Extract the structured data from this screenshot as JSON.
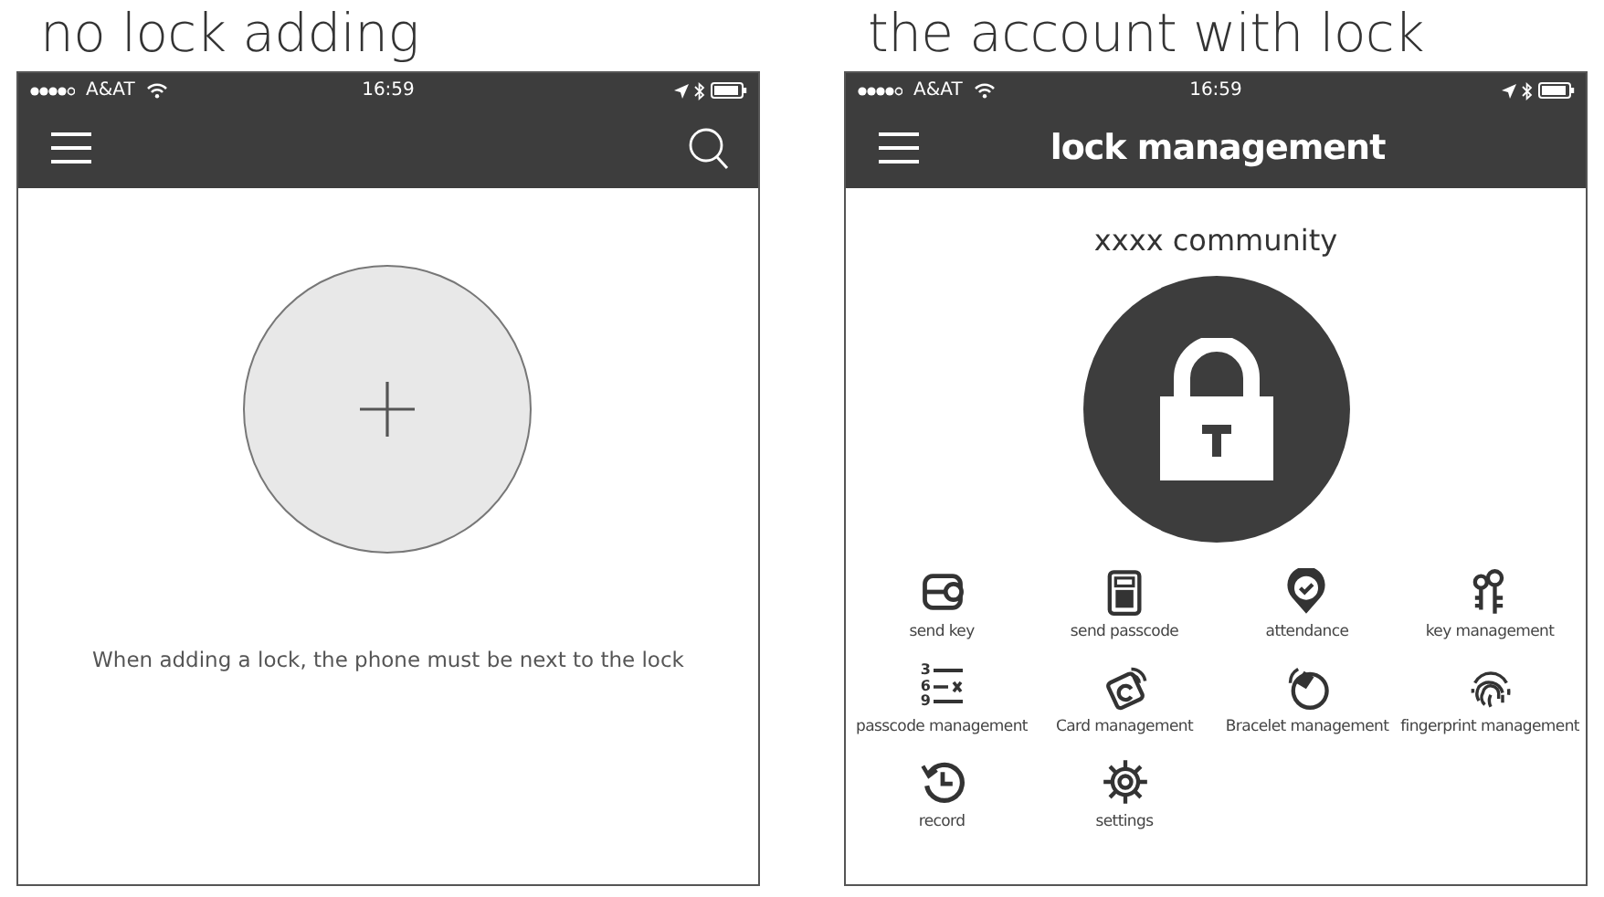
{
  "empty_screen": {
    "caption": "no lock adding",
    "status_bar": {
      "carrier": "A&AT",
      "time": "16:59"
    },
    "hint": "When adding a lock, the phone must be next to the lock"
  },
  "lock_screen": {
    "caption": "the account with lock",
    "status_bar": {
      "carrier": "A&AT",
      "time": "16:59"
    },
    "title": "lock management",
    "community": "xxxx community",
    "features": [
      {
        "label": "send key"
      },
      {
        "label": "send passcode"
      },
      {
        "label": "attendance"
      },
      {
        "label": "key management"
      },
      {
        "label": "passcode management",
        "icon_digits": [
          "3",
          "6",
          "9"
        ]
      },
      {
        "label": "Card management"
      },
      {
        "label": "Bracelet management"
      },
      {
        "label": "fingerprint management"
      },
      {
        "label": "record"
      },
      {
        "label": "settings"
      }
    ]
  }
}
